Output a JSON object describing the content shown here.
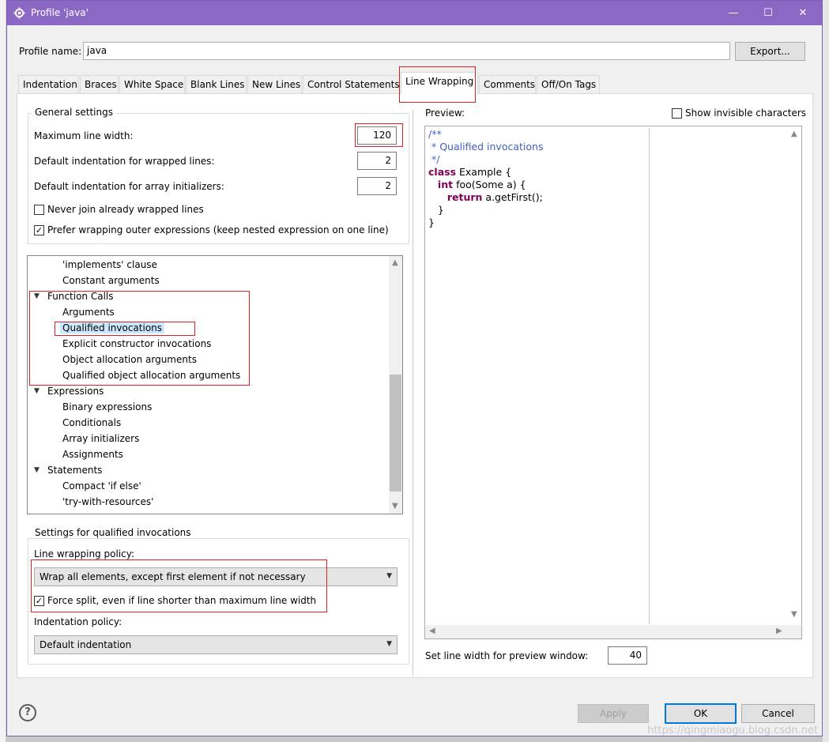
{
  "window": {
    "title": "Profile 'java'",
    "controls": {
      "minimize": "—",
      "maximize": "☐",
      "close": "✕"
    }
  },
  "profile": {
    "name_label": "Profile name:",
    "name_value": "java",
    "export_label": "Export..."
  },
  "tabs": [
    {
      "label": "Indentation"
    },
    {
      "label": "Braces"
    },
    {
      "label": "White Space"
    },
    {
      "label": "Blank Lines"
    },
    {
      "label": "New Lines"
    },
    {
      "label": "Control Statements"
    },
    {
      "label": "Line Wrapping"
    },
    {
      "label": "Comments"
    },
    {
      "label": "Off/On Tags"
    }
  ],
  "general": {
    "title": "General settings",
    "max_width_label": "Maximum line width:",
    "max_width_value": "120",
    "wrap_indent_label": "Default indentation for wrapped lines:",
    "wrap_indent_value": "2",
    "array_indent_label": "Default indentation for array initializers:",
    "array_indent_value": "2",
    "never_join_label": "Never join already wrapped lines",
    "never_join_checked": false,
    "prefer_outer_label": "Prefer wrapping outer expressions (keep nested expression on one line)",
    "prefer_outer_checked": true
  },
  "tree": {
    "items": [
      {
        "label": "'implements' clause",
        "level": 1
      },
      {
        "label": "Constant arguments",
        "level": 1
      },
      {
        "label": "Function Calls",
        "level": 0,
        "expanded": true
      },
      {
        "label": "Arguments",
        "level": 1
      },
      {
        "label": "Qualified invocations",
        "level": 1,
        "selected": true
      },
      {
        "label": "Explicit constructor invocations",
        "level": 1
      },
      {
        "label": "Object allocation arguments",
        "level": 1
      },
      {
        "label": "Qualified object allocation arguments",
        "level": 1
      },
      {
        "label": "Expressions",
        "level": 0,
        "expanded": true
      },
      {
        "label": "Binary expressions",
        "level": 1
      },
      {
        "label": "Conditionals",
        "level": 1
      },
      {
        "label": "Array initializers",
        "level": 1
      },
      {
        "label": "Assignments",
        "level": 1
      },
      {
        "label": "Statements",
        "level": 0,
        "expanded": true
      },
      {
        "label": "Compact 'if else'",
        "level": 1
      },
      {
        "label": "'try-with-resources'",
        "level": 1
      }
    ]
  },
  "qualified": {
    "title": "Settings for qualified invocations",
    "policy_label": "Line wrapping policy:",
    "policy_value": "Wrap all elements, except first element if not necessary",
    "force_split_label": "Force split, even if line shorter than maximum line width",
    "force_split_checked": true,
    "indent_policy_label": "Indentation policy:",
    "indent_policy_value": "Default indentation"
  },
  "preview": {
    "label": "Preview:",
    "show_invisible_label": "Show invisible characters",
    "show_invisible_checked": false,
    "line_width_label": "Set line width for preview window:",
    "line_width_value": "40"
  },
  "buttons": {
    "apply": "Apply",
    "ok": "OK",
    "cancel": "Cancel",
    "help": "?"
  },
  "watermark": "https://qingmiaogu.blog.csdn.net",
  "colors": {
    "titlebar": "#8b68c4",
    "highlight": "#e02020",
    "selection": "#cce8ff",
    "keyword": "#7f0055",
    "comment": "#3f5fbf"
  }
}
